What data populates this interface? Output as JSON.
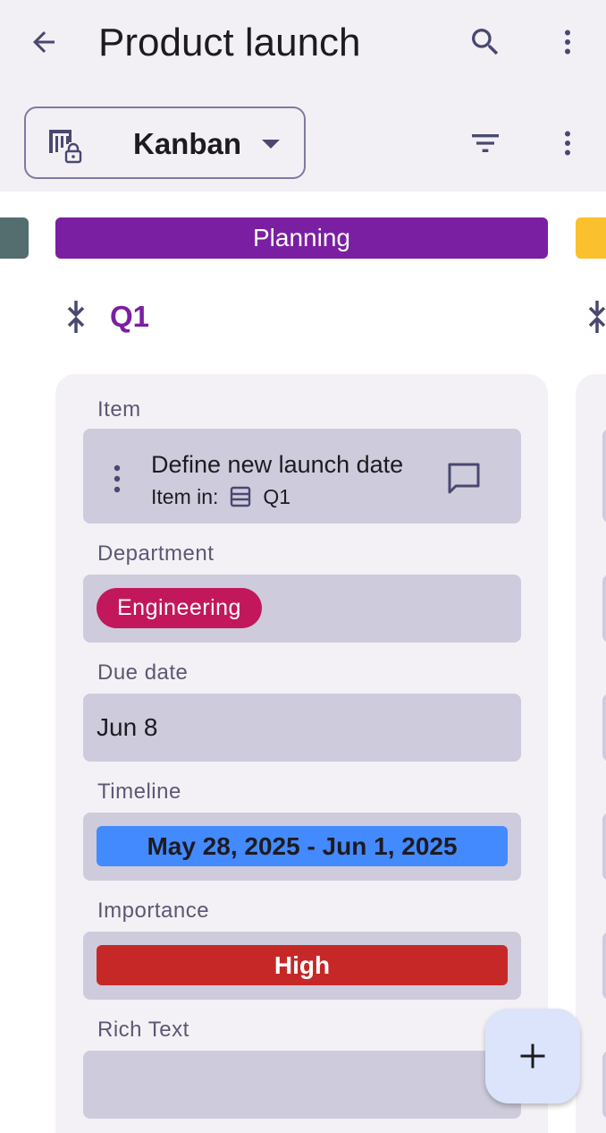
{
  "header": {
    "title": "Product launch",
    "back_icon": "arrow-back-icon",
    "search_icon": "search-icon",
    "more_icon": "more-vert-icon"
  },
  "view": {
    "label": "Kanban",
    "icon": "kanban-locked-icon",
    "dropdown_icon": "caret-down-icon",
    "filter_icon": "filter-icon",
    "more_icon": "more-vert-icon"
  },
  "board": {
    "column": {
      "title": "Planning",
      "color": "#7b1fa2"
    },
    "prev_column_color": "#546e70",
    "next_column_color": "#fbc02d",
    "group": {
      "title": "Q1",
      "collapse_icon": "collapse-icon"
    },
    "card": {
      "item": {
        "label": "Item",
        "name": "Define new launch date",
        "sub_prefix": "Item in:",
        "sub_table": "Q1"
      },
      "department": {
        "label": "Department",
        "value": "Engineering",
        "color": "#c2185b"
      },
      "due_date": {
        "label": "Due date",
        "value": "Jun 8"
      },
      "timeline": {
        "label": "Timeline",
        "value": "May 28, 2025 - Jun 1, 2025",
        "color": "#448aff"
      },
      "importance": {
        "label": "Importance",
        "value": "High",
        "color": "#c62828"
      },
      "rich_text": {
        "label": "Rich Text",
        "value": ""
      }
    }
  },
  "fab": {
    "icon": "plus-icon"
  }
}
